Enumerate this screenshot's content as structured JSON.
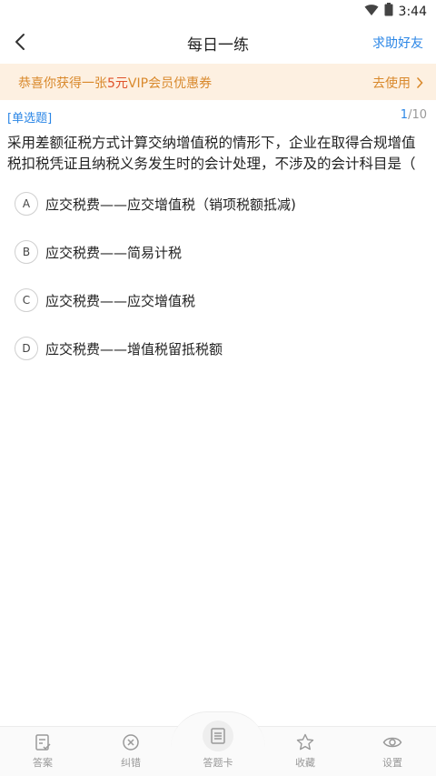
{
  "status_bar": {
    "time": "3:44",
    "icons": [
      "wifi-icon",
      "battery-icon"
    ]
  },
  "header": {
    "title": "每日一练",
    "right_action": "求助好友",
    "back_icon": "chevron-left-icon"
  },
  "banner": {
    "text_prefix": "恭喜你获得一张",
    "text_highlight": "5元",
    "text_suffix": "VIP会员优惠券",
    "action_label": "去使用"
  },
  "question": {
    "type_label": "[单选题]",
    "progress_current": "1",
    "progress_total": "/10",
    "line1": "采用差额征税方式计算交纳增值税的情形下，企业在取得合规增值",
    "line2": "税扣税凭证且纳税义务发生时的会计处理，不涉及的会计科目是（",
    "options": [
      {
        "letter": "A",
        "text": "应交税费——应交增值税（销项税额抵减)"
      },
      {
        "letter": "B",
        "text": "应交税费——简易计税"
      },
      {
        "letter": "C",
        "text": "应交税费——应交增值税"
      },
      {
        "letter": "D",
        "text": "应交税费——增值税留抵税额"
      }
    ]
  },
  "tabbar": [
    {
      "label": "答案",
      "icon": "answer-icon"
    },
    {
      "label": "纠错",
      "icon": "error-correction-icon"
    },
    {
      "label": "答题卡",
      "icon": "answer-card-icon"
    },
    {
      "label": "收藏",
      "icon": "star-icon"
    },
    {
      "label": "设置",
      "icon": "eye-icon"
    }
  ],
  "colors": {
    "accent": "#2b86e6",
    "banner_bg": "#fdf0e1",
    "banner_text": "#d9892c",
    "highlight": "#e0522a"
  }
}
